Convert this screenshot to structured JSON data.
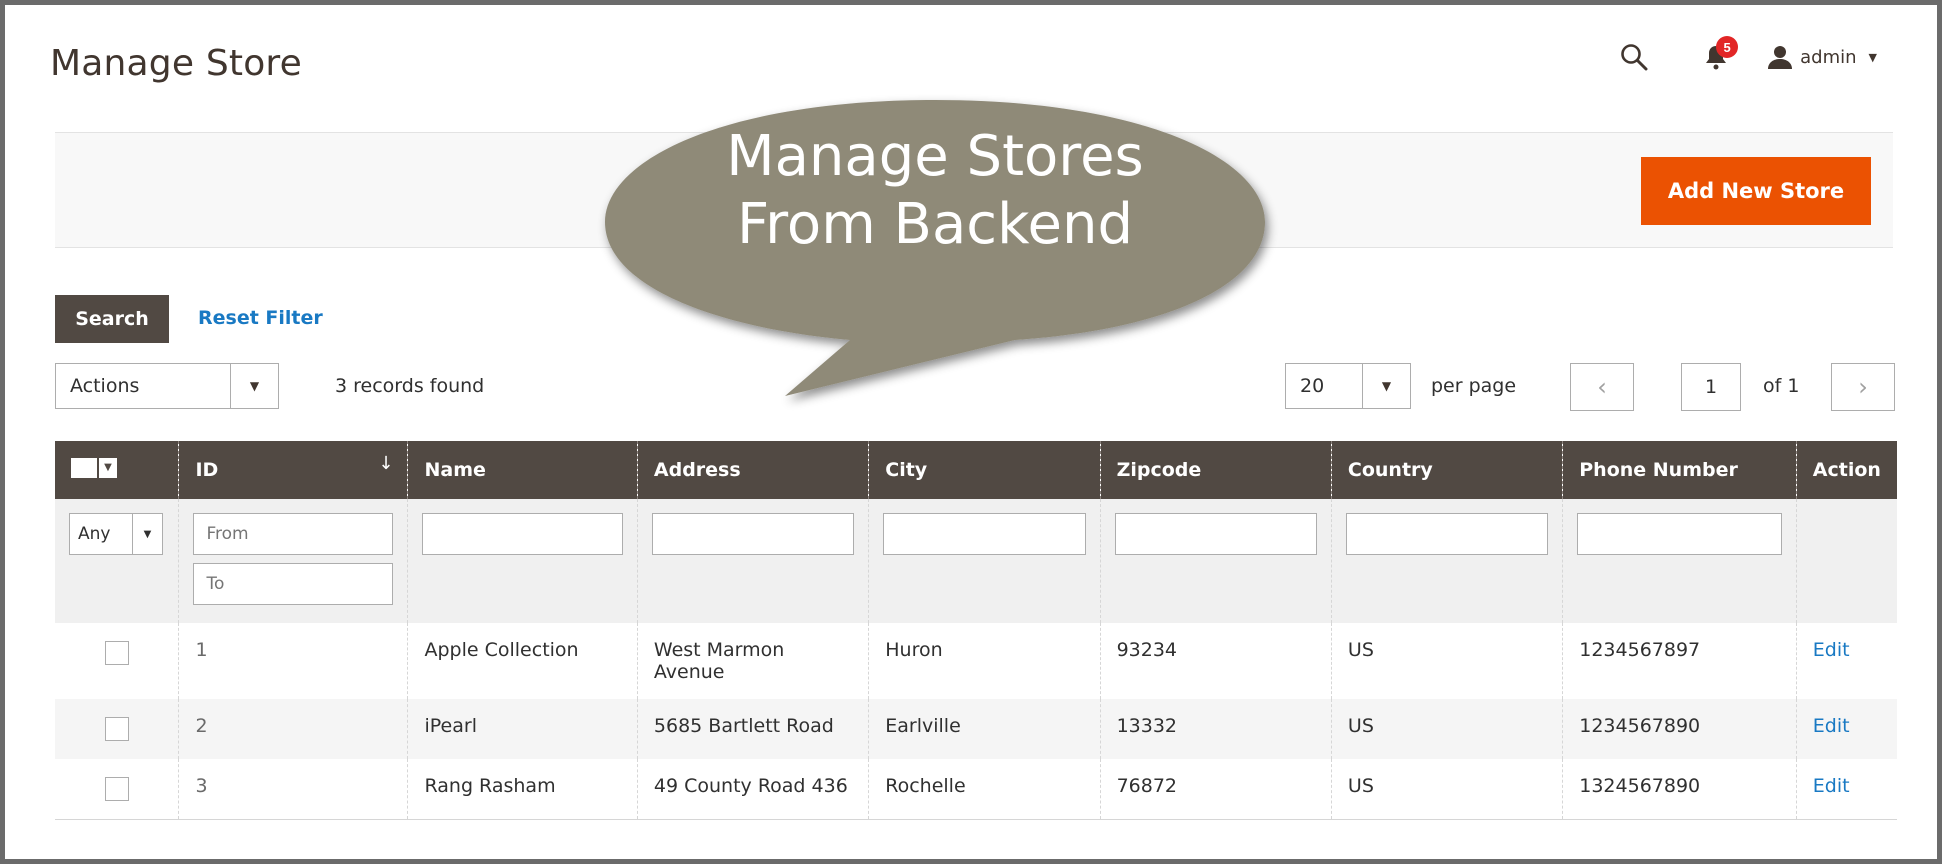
{
  "header": {
    "title": "Manage Store",
    "notification_count": "5",
    "user_name": "admin"
  },
  "actions": {
    "add_new_store_label": "Add New Store"
  },
  "callout": {
    "line1": "Manage Stores",
    "line2": "From Backend"
  },
  "toolbar": {
    "search_label": "Search",
    "reset_filter_label": "Reset Filter",
    "actions_select_value": "Actions",
    "records_found": "3 records found",
    "per_page_value": "20",
    "per_page_label": "per page",
    "current_page": "1",
    "total_pages_label": "of 1"
  },
  "grid": {
    "columns": [
      "ID",
      "Name",
      "Address",
      "City",
      "Zipcode",
      "Country",
      "Phone Number",
      "Action"
    ],
    "filters": {
      "any_value": "Any",
      "id_from_placeholder": "From",
      "id_to_placeholder": "To"
    },
    "rows": [
      {
        "id": "1",
        "name": "Apple Collection",
        "address": "West Marmon Avenue",
        "city": "Huron",
        "zipcode": "93234",
        "country": "US",
        "phone": "1234567897",
        "action": "Edit"
      },
      {
        "id": "2",
        "name": "iPearl",
        "address": "5685 Bartlett Road",
        "city": "Earlville",
        "zipcode": "13332",
        "country": "US",
        "phone": "1234567890",
        "action": "Edit"
      },
      {
        "id": "3",
        "name": "Rang Rasham",
        "address": "49 County Road 436",
        "city": "Rochelle",
        "zipcode": "76872",
        "country": "US",
        "phone": "1324567890",
        "action": "Edit"
      }
    ]
  },
  "colors": {
    "accent": "#eb5202",
    "header_bg": "#514943",
    "link": "#1979c3",
    "callout": "#8f8a78"
  },
  "icons": {
    "search": "search-icon",
    "notifications": "bell-icon",
    "user": "user-icon"
  }
}
